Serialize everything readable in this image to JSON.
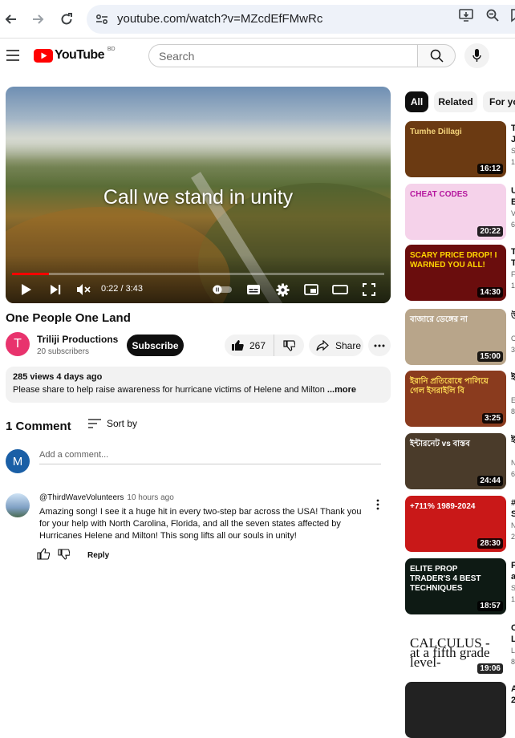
{
  "browser": {
    "url": "youtube.com/watch?v=MZcdEfFMwRc",
    "back_icon": "arrow-left-icon",
    "forward_icon": "arrow-right-icon",
    "reload_icon": "reload-icon"
  },
  "header": {
    "logo_text": "YouTube",
    "region": "BD",
    "search_placeholder": "Search"
  },
  "player": {
    "caption": "Call we stand in unity",
    "time": "0:22 / 3:43",
    "progress_fraction": 0.1
  },
  "video": {
    "title": "One People One Land",
    "channel_initial": "T",
    "channel_name": "Triliji Productions",
    "subscribers": "20 subscribers",
    "subscribe_label": "Subscribe",
    "likes": "267",
    "share_label": "Share",
    "stats": "285 views  4 days ago",
    "description": "Please share to help raise awareness for hurricane victims of Helene and Milton ",
    "more_label": "...more"
  },
  "comments": {
    "count_label": "1 Comment",
    "sort_label": "Sort by",
    "me_initial": "M",
    "add_placeholder": "Add a comment...",
    "items": [
      {
        "author": "@ThirdWaveVolunteers",
        "time": "10 hours ago",
        "text": "Amazing song! I see it a huge hit in every two-step bar across the USA! Thank you for your help with North Carolina, Florida, and all the seven states affected by Hurricanes Helene and Milton! This song lifts all our souls in unity!",
        "reply_label": "Reply"
      }
    ]
  },
  "sidebar": {
    "chips": [
      "All",
      "Related",
      "For you"
    ],
    "recommendations": [
      {
        "duration": "16:12",
        "thumb_text": "Tumhe Dillagi",
        "color": "#6b3a12",
        "info": [
          "T",
          "J",
          "S",
          "1"
        ]
      },
      {
        "duration": "20:22",
        "thumb_text": "CHEAT CODES",
        "color": "#f5d2ea",
        "info": [
          "U",
          "B",
          "V",
          "6"
        ]
      },
      {
        "duration": "14:30",
        "thumb_text": "SCARY PRICE DROP! I WARNED YOU ALL!",
        "color": "#6a0d0d",
        "info": [
          "T",
          "T",
          "F",
          "1"
        ]
      },
      {
        "duration": "15:00",
        "thumb_text": "বাজারে ডেঙ্গের না",
        "color": "#b8a58a",
        "info": [
          "উ",
          "",
          "C",
          "3"
        ]
      },
      {
        "duration": "3:25",
        "thumb_text": "ইরানি প্রতিরোধে পালিয়ে গেল ইসরাইলি বি",
        "color": "#8a3b1e",
        "info": [
          "ই",
          "",
          "E",
          "8"
        ]
      },
      {
        "duration": "24:44",
        "thumb_text": "ইন্টারনেট vs বাস্তব",
        "color": "#4a3b2a",
        "info": [
          "ই",
          "",
          "N",
          "6"
        ]
      },
      {
        "duration": "28:30",
        "thumb_text": "+711% 1989-2024",
        "color": "#c91818",
        "info": [
          "#",
          "S",
          "N",
          "2"
        ]
      },
      {
        "duration": "18:57",
        "thumb_text": "ELITE PROP TRADER'S 4 BEST TECHNIQUES",
        "color": "#0e1a14",
        "info": [
          "F",
          "a",
          "S",
          "1"
        ]
      },
      {
        "duration": "19:06",
        "thumb_text": "CALCULUS -at a fifth grade level-",
        "color": "#ffffff",
        "info": [
          "C",
          "L",
          "L",
          "8"
        ]
      },
      {
        "duration": "",
        "thumb_text": "",
        "color": "#222222",
        "info": [
          "A",
          "2"
        ]
      }
    ]
  }
}
